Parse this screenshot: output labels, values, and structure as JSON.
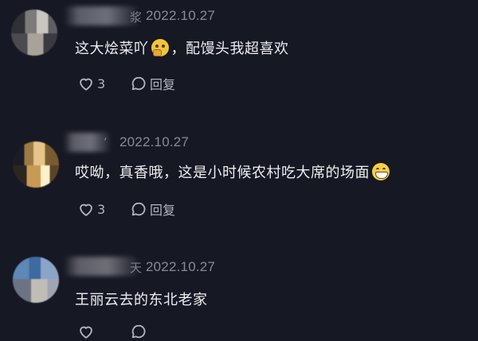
{
  "comments": [
    {
      "name_tail": "浆",
      "date": "2022.10.27",
      "text_before": "这大烩菜吖",
      "emoji": "thinking-face",
      "text_after": "，配馒头我超喜欢",
      "likes": "3",
      "reply_label": "回复"
    },
    {
      "name_tail": "ʻ",
      "date": "2022.10.27",
      "text_before": "哎呦，真香哦，这是小时候农村吃大席的场面",
      "emoji": "grinning-face",
      "text_after": "",
      "likes": "3",
      "reply_label": "回复"
    },
    {
      "name_tail": "天",
      "date": "2022.10.27",
      "text_before": "王丽云去的东北老家",
      "emoji": "",
      "text_after": "",
      "likes": "",
      "reply_label": ""
    }
  ],
  "colors": {
    "background": "#161823",
    "text": "#eeeef0",
    "meta": "#8a8b93"
  }
}
